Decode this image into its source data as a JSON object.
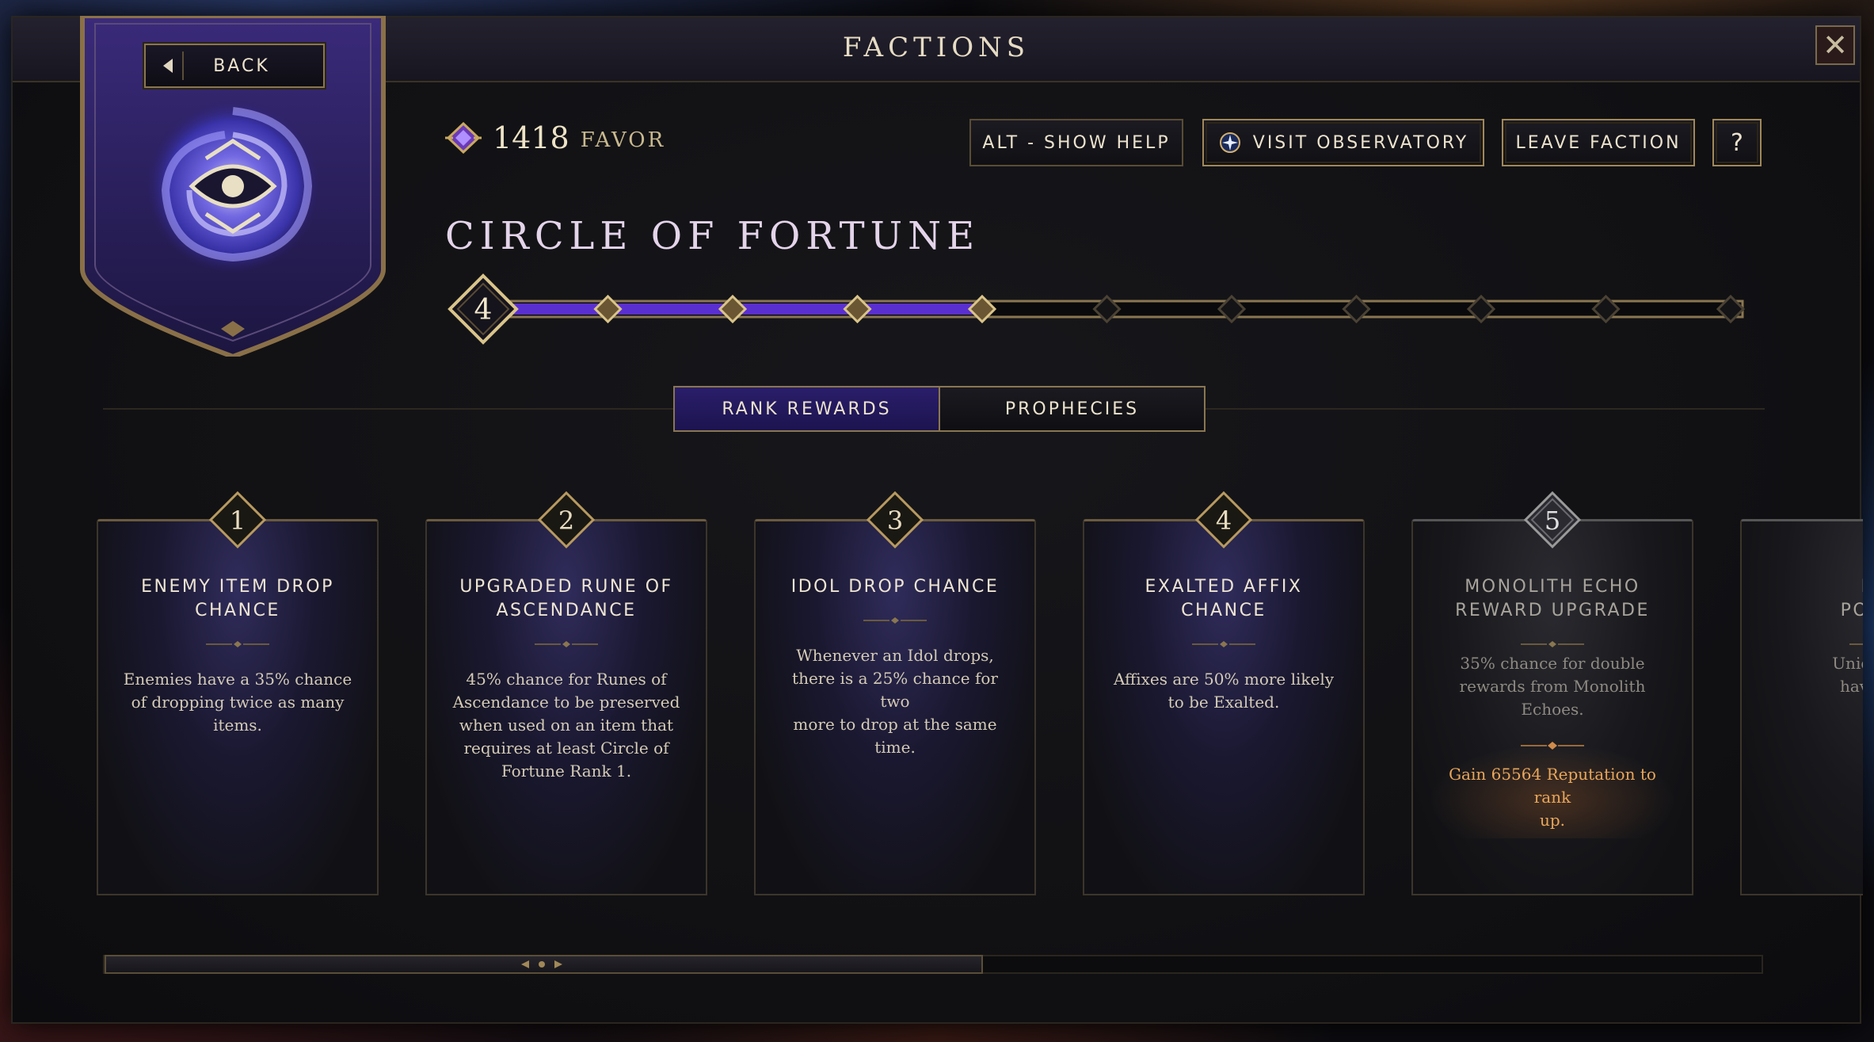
{
  "window": {
    "title": "FACTIONS"
  },
  "nav": {
    "back_label": "BACK"
  },
  "favor": {
    "amount": "1418",
    "label": "FAVOR"
  },
  "header_buttons": {
    "help_label": "ALT - SHOW HELP",
    "observatory_label": "VISIT OBSERVATORY",
    "leave_label": "LEAVE FACTION",
    "question_label": "?"
  },
  "faction": {
    "name": "CIRCLE OF FORTUNE",
    "current_rank": "4",
    "max_rank": 11,
    "progress_rank": 4,
    "banner_icon": "eye-vortex-emblem"
  },
  "tabs": [
    {
      "label": "RANK REWARDS",
      "active": true
    },
    {
      "label": "PROPHECIES",
      "active": false
    }
  ],
  "rewards": [
    {
      "rank": "1",
      "title_1": "ENEMY ITEM DROP",
      "title_2": "CHANCE",
      "desc": [
        "Enemies have a 35% chance",
        "of dropping twice as many",
        "items."
      ]
    },
    {
      "rank": "2",
      "title_1": "UPGRADED RUNE OF",
      "title_2": "ASCENDANCE",
      "desc": [
        "45% chance for Runes of",
        "Ascendance to be preserved",
        "when used on an item that",
        "requires at least Circle of",
        "Fortune Rank 1."
      ]
    },
    {
      "rank": "3",
      "title_1": "IDOL DROP CHANCE",
      "title_2": "",
      "desc": [
        "Whenever an Idol drops,",
        "there is a 25% chance for two",
        "more to drop at the same",
        "time."
      ]
    },
    {
      "rank": "4",
      "title_1": "EXALTED AFFIX",
      "title_2": "CHANCE",
      "desc": [
        "Affixes are 50% more likely",
        "to be Exalted."
      ]
    },
    {
      "rank": "5",
      "title_1": "MONOLITH ECHO",
      "title_2": "REWARD UPGRADE",
      "desc": [
        "35% chance for double",
        "rewards from Monolith",
        "Echoes."
      ],
      "rankup": [
        "Gain 65564 Reputation to rank",
        "up."
      ]
    },
    {
      "rank": "",
      "title_1": "LEG",
      "title_2": "POTENT",
      "desc": [
        "Uniques are",
        "have Lege"
      ]
    }
  ],
  "scroll": {
    "position_fraction": 0.53
  },
  "colors": {
    "accent_purple": "#5a2fd0",
    "gold": "#a08858",
    "rankup_orange": "#e8a65a"
  }
}
